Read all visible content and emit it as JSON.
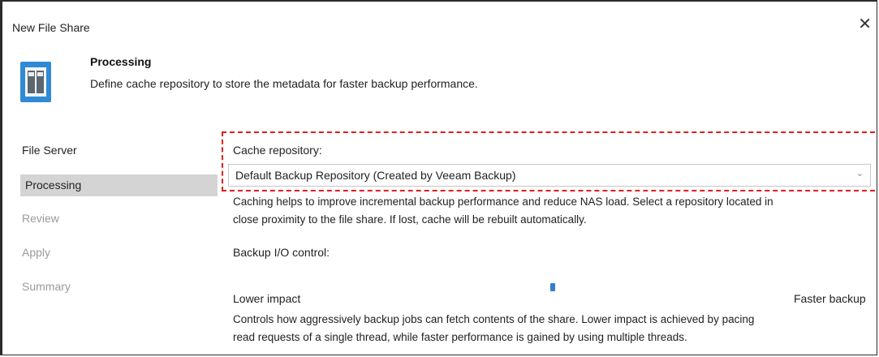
{
  "window": {
    "title": "New File Share",
    "close_glyph": "✕",
    "icon": "file-share-icon"
  },
  "header": {
    "step_title": "Processing",
    "step_description": "Define cache repository to store the metadata for faster backup performance."
  },
  "nav": {
    "items": [
      {
        "label": "File Server",
        "state": "done"
      },
      {
        "label": "Processing",
        "state": "active"
      },
      {
        "label": "Review",
        "state": "disabled"
      },
      {
        "label": "Apply",
        "state": "disabled"
      },
      {
        "label": "Summary",
        "state": "disabled"
      }
    ]
  },
  "cache": {
    "label": "Cache repository:",
    "selected": "Default Backup Repository (Created by Veeam Backup)",
    "help_line1": "Caching helps to improve incremental backup performance and reduce NAS load. Select a repository located in",
    "help_line2": "close proximity to the file share. If lost, cache will be rebuilt automatically."
  },
  "io_control": {
    "label": "Backup I/O control:",
    "min_label": "Lower impact",
    "max_label": "Faster backup",
    "help_line1": "Controls how aggressively backup jobs can fetch contents of the share. Lower impact is achieved by pacing",
    "help_line2": "read requests of a single thread, while faster performance is gained by using multiple threads."
  },
  "colors": {
    "highlight_border": "#e0201c",
    "accent": "#2f7fd0",
    "nav_active_bg": "#d4d4d4"
  }
}
